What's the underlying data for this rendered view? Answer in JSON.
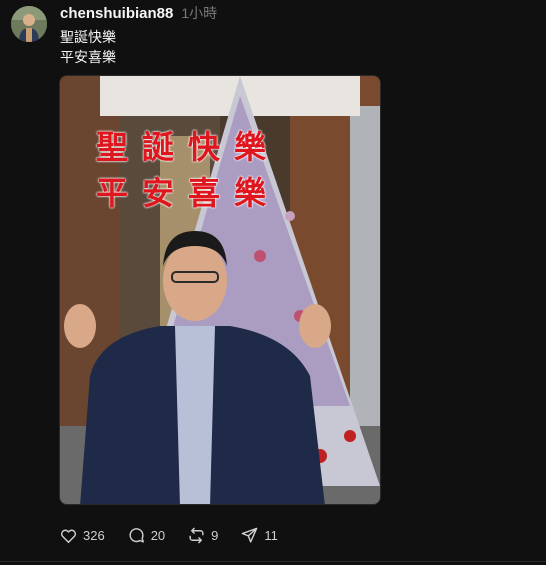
{
  "post": {
    "username": "chenshuibian88",
    "time": "1小時",
    "text_lines": [
      "聖誕快樂",
      "平安喜樂"
    ],
    "image": {
      "overlay_line1": "聖誕快樂",
      "overlay_line2": "平安喜樂"
    }
  },
  "actions": {
    "likes": "326",
    "comments": "20",
    "reposts": "9",
    "shares": "11"
  },
  "colors": {
    "background": "#101010",
    "overlay_text": "#e0161e"
  },
  "icons": [
    "heart-icon",
    "comment-icon",
    "repost-icon",
    "share-icon"
  ]
}
